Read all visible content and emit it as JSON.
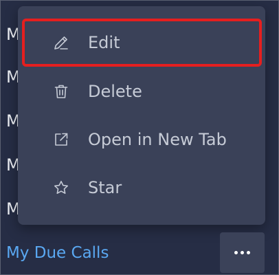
{
  "background_items": [
    "M",
    "M",
    "M",
    "M",
    "M"
  ],
  "menu": {
    "items": [
      {
        "label": "Edit",
        "icon": "pencil-icon"
      },
      {
        "label": "Delete",
        "icon": "trash-icon"
      },
      {
        "label": "Open in New Tab",
        "icon": "external-link-icon"
      },
      {
        "label": "Star",
        "icon": "star-icon"
      }
    ],
    "selected_item": "Edit"
  },
  "bottom": {
    "link_label": "My Due Calls",
    "more_icon": "more-horizontal-icon"
  },
  "colors": {
    "background": "#262d45",
    "menu_background": "#3a4158",
    "menu_text": "#c6cbd6",
    "link": "#5aa8f2",
    "highlight": "#e51f1f"
  }
}
